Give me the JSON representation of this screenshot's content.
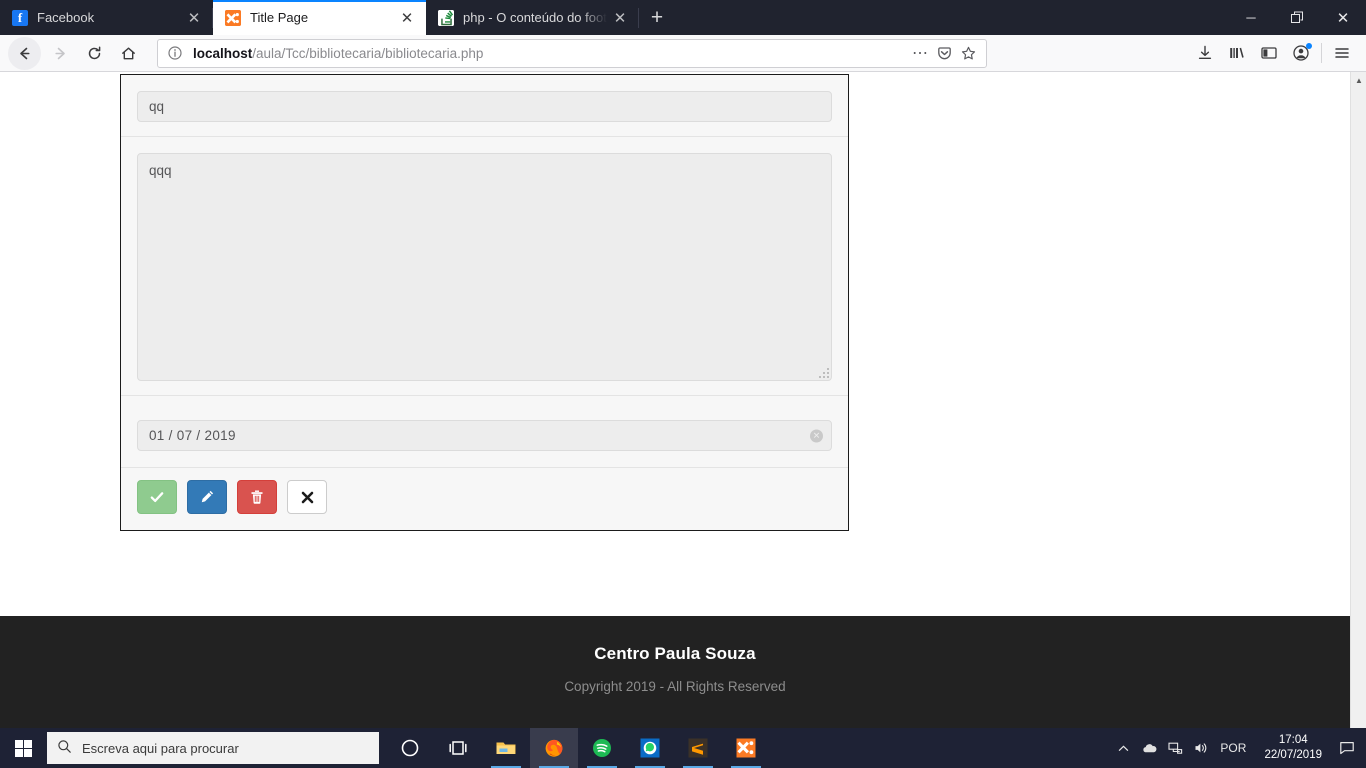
{
  "browser": {
    "tabs": [
      {
        "title": "Facebook",
        "favicon": "facebook-icon",
        "active": false
      },
      {
        "title": "Title Page",
        "favicon": "xampp-icon",
        "active": true
      },
      {
        "title": "php - O conteúdo do footer nã",
        "favicon": "stackoverflow-icon",
        "active": false
      }
    ],
    "new_tab_label": "+",
    "window_controls": {
      "minimize": "─",
      "maximize": "❐",
      "close": "✕"
    },
    "nav": {
      "back": "back-button",
      "forward": "forward-button",
      "reload": "reload-button",
      "home": "home-button"
    },
    "url": {
      "host": "localhost",
      "path": "/aula/Tcc/bibliotecaria/bibliotecaria.php",
      "full": "localhost/aula/Tcc/bibliotecaria/bibliotecaria.php",
      "identity_icon": "info-circle-icon",
      "page_actions": "ellipsis-icon",
      "reader_icon": "pocket-icon",
      "bookmark_icon": "star-icon"
    },
    "toolbar": {
      "downloads": "download-icon",
      "library": "library-icon",
      "sidebar": "sidebar-icon",
      "account": "account-icon",
      "menu": "hamburger-menu-icon"
    }
  },
  "page": {
    "form": {
      "title_input": {
        "value": "qq",
        "placeholder": ""
      },
      "description_textarea": {
        "value": "qqq",
        "placeholder": ""
      },
      "date_input": {
        "value": "01 / 07 / 2019",
        "clear_label": "✕"
      },
      "buttons": [
        {
          "name": "confirm",
          "icon": "check-icon",
          "glyph": "✔",
          "color": "#8fcb8f"
        },
        {
          "name": "edit",
          "icon": "pencil-icon",
          "glyph": "✎",
          "color": "#337ab7"
        },
        {
          "name": "delete",
          "icon": "trash-icon",
          "glyph": "🗑",
          "color": "#d9534f"
        },
        {
          "name": "cancel",
          "icon": "close-x-icon",
          "glyph": "✖",
          "color": "#ffffff"
        }
      ]
    },
    "footer": {
      "title": "Centro Paula Souza",
      "copyright": "Copyright 2019 - All Rights Reserved"
    }
  },
  "taskbar": {
    "start": "windows-start-icon",
    "search_placeholder": "Escreva aqui para procurar",
    "search_icon": "search-icon",
    "apps": [
      {
        "name": "cortana",
        "icon": "cortana-circle-icon"
      },
      {
        "name": "task-view",
        "icon": "task-view-icon"
      },
      {
        "name": "file-explorer",
        "icon": "file-explorer-icon"
      },
      {
        "name": "firefox",
        "icon": "firefox-icon"
      },
      {
        "name": "spotify",
        "icon": "spotify-icon"
      },
      {
        "name": "whatsapp",
        "icon": "whatsapp-icon"
      },
      {
        "name": "sublime-text",
        "icon": "sublime-text-icon"
      },
      {
        "name": "xampp",
        "icon": "xampp-icon"
      }
    ],
    "tray": {
      "overflow": "chevron-up-icon",
      "onedrive": "cloud-icon",
      "network": "network-icon",
      "volume": "speaker-icon",
      "language": "POR",
      "time": "17:04",
      "date": "22/07/2019",
      "action_center": "notification-icon"
    }
  }
}
